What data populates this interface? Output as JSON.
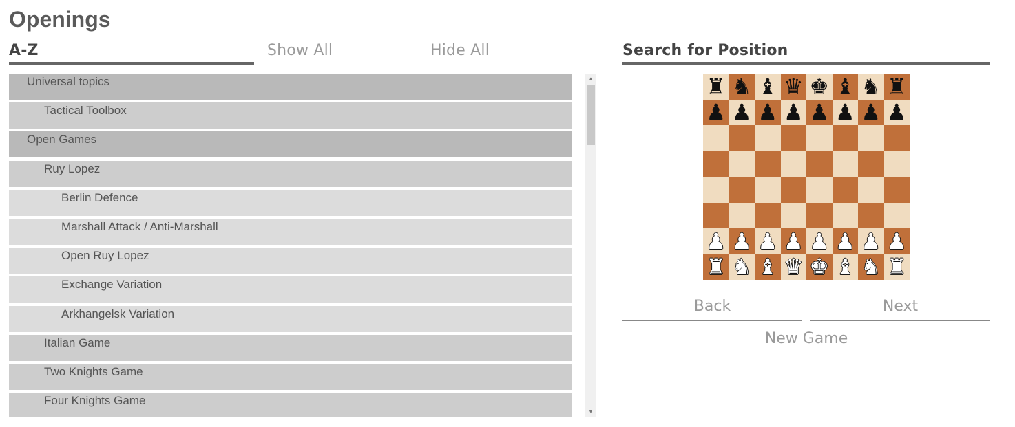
{
  "page": {
    "title": "Openings"
  },
  "tabs": {
    "az": "A-Z",
    "show_all": "Show All",
    "hide_all": "Hide All",
    "search": "Search for Position"
  },
  "openings": [
    {
      "label": "Universal topics",
      "level": 0
    },
    {
      "label": "Tactical Toolbox",
      "level": 1
    },
    {
      "label": "Open Games",
      "level": 0
    },
    {
      "label": "Ruy Lopez",
      "level": 1
    },
    {
      "label": "Berlin Defence",
      "level": 2
    },
    {
      "label": "Marshall Attack / Anti-Marshall",
      "level": 2
    },
    {
      "label": "Open Ruy Lopez",
      "level": 2
    },
    {
      "label": "Exchange Variation",
      "level": 2
    },
    {
      "label": "Arkhangelsk Variation",
      "level": 2
    },
    {
      "label": "Italian Game",
      "level": 1
    },
    {
      "label": "Two Knights Game",
      "level": 1
    },
    {
      "label": "Four Knights Game",
      "level": 1
    }
  ],
  "board": {
    "ranks": [
      "rnbqkbnr",
      "pppppppp",
      "........",
      "........",
      "........",
      "........",
      "PPPPPPPP",
      "RNBQKBNR"
    ],
    "light_color": "#f0dcc0",
    "dark_color": "#c0703a"
  },
  "controls": {
    "back": "Back",
    "next": "Next",
    "new_game": "New Game"
  }
}
